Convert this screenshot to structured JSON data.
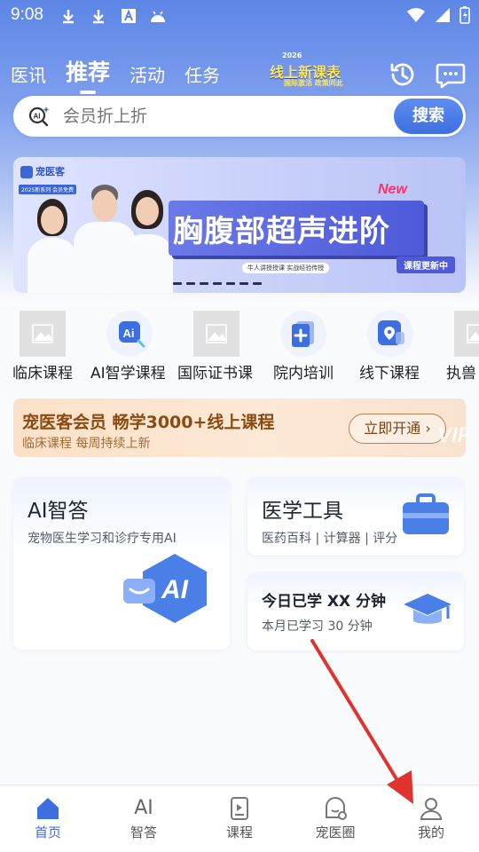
{
  "status_bar": {
    "time": "9:08"
  },
  "top_nav": {
    "tabs": [
      {
        "label": "医讯",
        "active": false
      },
      {
        "label": "推荐",
        "active": true
      },
      {
        "label": "活动",
        "active": false
      },
      {
        "label": "任务",
        "active": false
      }
    ],
    "promo": {
      "year_tag": "2026",
      "title": "线上新课表",
      "subtitle": "国际激活 政策同此"
    }
  },
  "search": {
    "placeholder": "会员折上折",
    "button": "搜索"
  },
  "banner": {
    "brand": "宠医客",
    "tag": "2025新系列 会员免费",
    "new_badge": "New",
    "title": "胸腹部超声进阶",
    "subtitle": "牛人讲授授课 实战经验传授",
    "update_badge": "课程更新中"
  },
  "categories": [
    {
      "label": "临床课程",
      "icon": "image-placeholder-icon"
    },
    {
      "label": "AI智学课程",
      "icon": "ai-icon"
    },
    {
      "label": "国际证书课",
      "icon": "image-placeholder-icon"
    },
    {
      "label": "院内培训",
      "icon": "plus-document-icon"
    },
    {
      "label": "线下课程",
      "icon": "location-pin-icon"
    },
    {
      "label": "执兽",
      "icon": "image-placeholder-icon"
    }
  ],
  "vip": {
    "title": "宠医客会员 畅学3000+线上课程",
    "subtitle": "临床课程 每周持续上新",
    "button": "立即开通",
    "deco": "VIP"
  },
  "cards": {
    "ai": {
      "title": "AI智答",
      "subtitle": "宠物医生学习和诊疗专用AI",
      "graphic": "AI"
    },
    "tools": {
      "title": "医学工具",
      "subtitle": "医药百科 | 计算器 | 评分"
    },
    "today": {
      "title": "今日已学 XX 分钟",
      "subtitle": "本月已学习 30 分钟"
    }
  },
  "bottom_nav": [
    {
      "label": "首页",
      "icon": "home-icon",
      "active": true
    },
    {
      "label": "智答",
      "icon": "ai-text-icon",
      "active": false,
      "icon_text": "AI"
    },
    {
      "label": "课程",
      "icon": "play-book-icon",
      "active": false
    },
    {
      "label": "宠医圈",
      "icon": "community-icon",
      "active": false
    },
    {
      "label": "我的",
      "icon": "profile-icon",
      "active": false
    }
  ],
  "colors": {
    "brand_blue": "#3d6fe0",
    "header_blue": "#5d86e6",
    "vip_brown": "#8a4a12",
    "annotation_red": "#e0322f"
  }
}
